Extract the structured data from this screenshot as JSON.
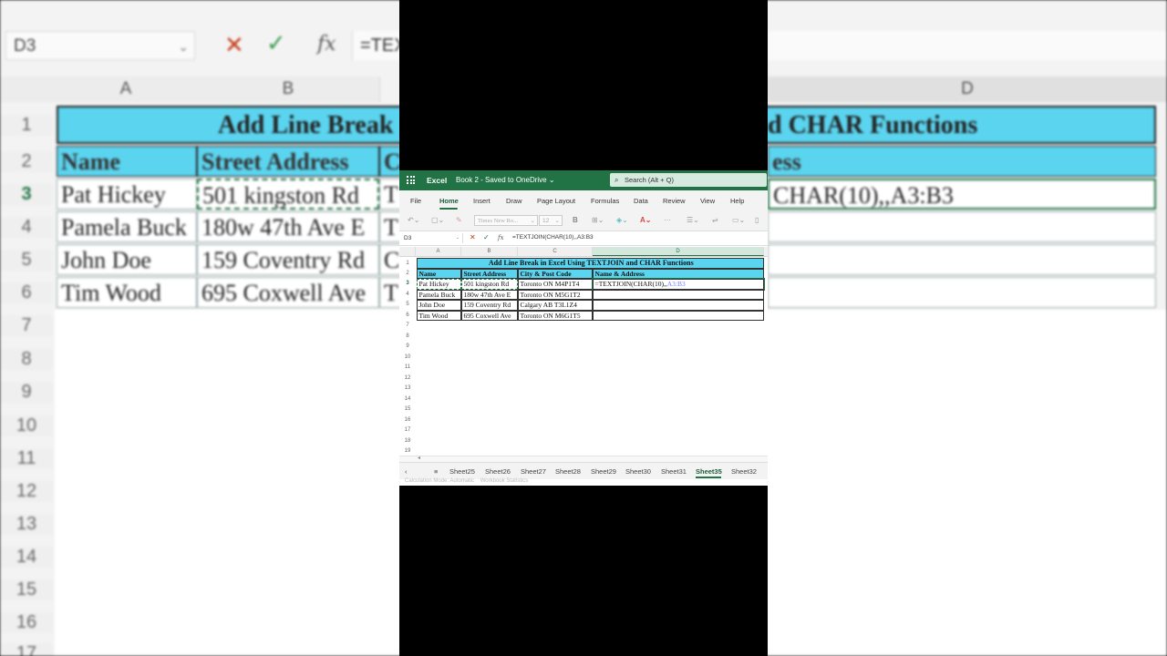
{
  "background": {
    "name_box": "D3",
    "formula": "=TEX",
    "columns": [
      "A",
      "B",
      "D"
    ],
    "rows": [
      "1",
      "2",
      "3",
      "4",
      "5",
      "6",
      "7",
      "8",
      "9",
      "10",
      "11",
      "12",
      "13",
      "14",
      "15",
      "16",
      "17"
    ],
    "title": "Add Line Break",
    "title_right": "d CHAR Functions",
    "headers": [
      "Name",
      "Street Address",
      "C",
      "ess"
    ],
    "data": [
      [
        "Pat Hickey",
        "501 kingston Rd",
        "T",
        "CHAR(10),,A3:B3"
      ],
      [
        "Pamela Buck",
        "180w 47th Ave E",
        "T",
        ""
      ],
      [
        "John Doe",
        "159 Coventry Rd",
        "C",
        ""
      ],
      [
        "Tim Wood",
        "695 Coxwell Ave",
        "T",
        ""
      ]
    ]
  },
  "excel": {
    "app_name": "Excel",
    "doc_title": "Book 2 - Saved to OneDrive",
    "search_placeholder": "Search (Alt + Q)",
    "menu": [
      "File",
      "Home",
      "Insert",
      "Draw",
      "Page Layout",
      "Formulas",
      "Data",
      "Review",
      "View",
      "Help"
    ],
    "active_menu": "Home",
    "font_name": "Times New Ro...",
    "font_size": "12",
    "name_box": "D3",
    "formula": "=TEXTJOIN(CHAR(10),,A3:B3",
    "columns": [
      "A",
      "B",
      "C",
      "D"
    ],
    "rows": [
      "1",
      "2",
      "3",
      "4",
      "5",
      "6",
      "7",
      "8",
      "9",
      "10",
      "11",
      "12",
      "13",
      "14",
      "15",
      "16",
      "17",
      "18",
      "19"
    ],
    "table": {
      "title": "Add Line Break in Excel Using TEXTJOIN and CHAR Functions",
      "headers": [
        "Name",
        "Street Address",
        "City & Post Code",
        "Name & Address"
      ],
      "rows": [
        [
          "Pat Hickey",
          "501 kingston Rd",
          "Toronto ON  M4P1T4",
          "=TEXTJOIN(CHAR(10),,",
          "A3:B3"
        ],
        [
          "Pamela Buck",
          "180w 47th Ave E",
          "Toronto ON M5G1T2",
          "",
          ""
        ],
        [
          "John Doe",
          "159 Coventry Rd",
          "Calgary AB T3L1Z4",
          "",
          ""
        ],
        [
          "Tim Wood",
          "695 Coxwell Ave",
          "Toronto ON M6G1T5",
          "",
          ""
        ]
      ]
    },
    "sheet_tabs": [
      "Sheet25",
      "Sheet26",
      "Sheet27",
      "Sheet28",
      "Sheet29",
      "Sheet30",
      "Sheet31",
      "Sheet35",
      "Sheet32"
    ],
    "active_sheet": "Sheet35",
    "status_text": "Calculation Mode: Automatic    Workbook Statistics"
  }
}
